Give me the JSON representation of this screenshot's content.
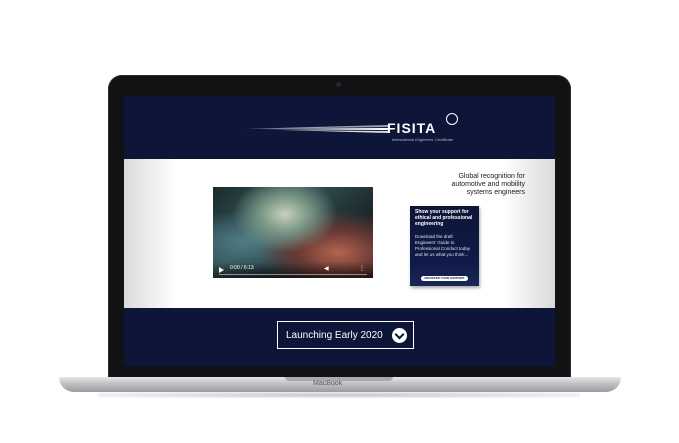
{
  "device": {
    "brand_label": "MacBook"
  },
  "header": {
    "logo_text": "FISITA",
    "logo_subtext": "International Engineers' Certificate",
    "background_color": "#0d1538"
  },
  "hero": {
    "tagline_line1": "Global recognition for",
    "tagline_line2": "automotive and mobility",
    "tagline_line3": "systems engineers"
  },
  "video": {
    "time": "0:00 / 6:13",
    "play_icon": "play-icon",
    "volume_icon": "volume-icon",
    "menu_icon": "more-options-icon"
  },
  "promo_card": {
    "title": "Show your support for ethical and professional engineering",
    "body": "Download the draft Engineers' Guide to Professional Conduct today and let us what you think...",
    "button_label": "REGISTER YOUR SUPPORT"
  },
  "footer": {
    "launch_text": "Launching Early 2020",
    "launch_icon": "chevron-down-icon"
  }
}
